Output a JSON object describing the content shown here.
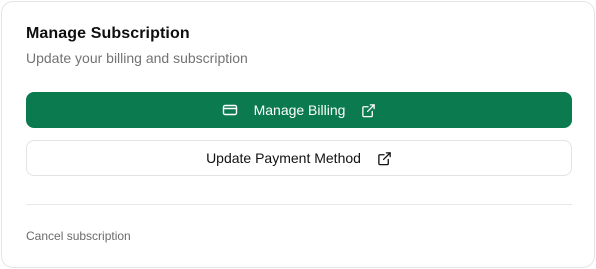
{
  "card": {
    "title": "Manage Subscription",
    "subtitle": "Update your billing and subscription"
  },
  "actions": {
    "manage_billing_label": "Manage Billing",
    "manage_billing_icon": "credit-card-icon",
    "update_payment_label": "Update Payment Method",
    "external_link_icon": "external-link-icon"
  },
  "footer": {
    "cancel_label": "Cancel subscription"
  },
  "colors": {
    "primary_button": "#0b7a4f",
    "subtitle_text": "#737373",
    "border": "#e5e5e5"
  }
}
